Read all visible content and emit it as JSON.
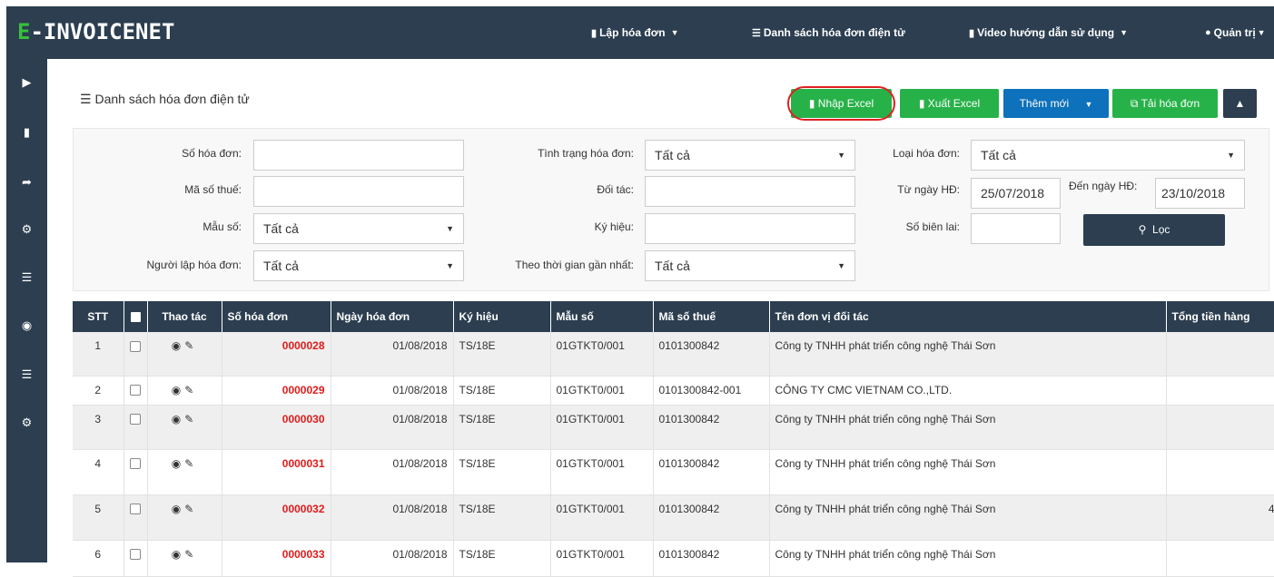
{
  "app": {
    "logo_e": "E",
    "logo_rest": "-INVOICENET"
  },
  "topnav": [
    {
      "icon": "file-icon",
      "label": "Lập hóa đơn",
      "caret": true
    },
    {
      "icon": "list-icon",
      "label": "Danh sách hóa đơn điện tử",
      "caret": false
    },
    {
      "icon": "file-icon",
      "label": "Video hướng dẫn sử dụng",
      "caret": true
    },
    {
      "icon": "user-icon",
      "label": "Quản trị",
      "caret": true
    }
  ],
  "sidebar": [
    "play-icon",
    "file-icon",
    "share-icon",
    "cogs-icon",
    "list-icon",
    "users-icon",
    "list-icon",
    "cogs-icon"
  ],
  "panel": {
    "title": "Danh sách hóa đơn điện tử"
  },
  "toolbar": {
    "import_excel": "Nhập Excel",
    "export_excel": "Xuất Excel",
    "add_new": "Thêm mới",
    "download": "Tải hóa đơn"
  },
  "filters": {
    "invoice_no_label": "Số hóa đơn:",
    "tax_code_label": "Mã số thuế:",
    "template_label": "Mẫu số:",
    "template_value": "Tất cả",
    "creator_label": "Người lập hóa đơn:",
    "creator_value": "Tất cả",
    "status_label": "Tình trạng hóa đơn:",
    "status_value": "Tất cả",
    "partner_label": "Đối tác:",
    "symbol_label": "Ký hiệu:",
    "recent_label": "Theo thời gian gần nhất:",
    "recent_value": "Tất cả",
    "type_label": "Loại hóa đơn:",
    "type_value": "Tất cả",
    "from_label": "Từ ngày HĐ:",
    "from_value": "25/07/2018",
    "to_label": "Đến ngày HĐ:",
    "to_value": "23/10/2018",
    "receipt_label": "Số biên lai:",
    "filter_button": "Lọc"
  },
  "table": {
    "headers": [
      "STT",
      "",
      "Thao tác",
      "Số hóa đơn",
      "Ngày hóa đơn",
      "Ký hiệu",
      "Mẫu số",
      "Mã số thuế",
      "Tên đơn vị đối tác",
      "Tổng tiền hàng"
    ],
    "rows": [
      {
        "stt": "1",
        "no": "0000028",
        "date": "01/08/2018",
        "symbol": "TS/18E",
        "template": "01GTKT0/001",
        "tax": "0101300842",
        "partner": "Công ty TNHH phát triển công nghệ Thái Sơn",
        "total": ""
      },
      {
        "stt": "2",
        "no": "0000029",
        "date": "01/08/2018",
        "symbol": "TS/18E",
        "template": "01GTKT0/001",
        "tax": "0101300842-001",
        "partner": "CÔNG TY CMC VIETNAM CO.,LTD.",
        "total": ""
      },
      {
        "stt": "3",
        "no": "0000030",
        "date": "01/08/2018",
        "symbol": "TS/18E",
        "template": "01GTKT0/001",
        "tax": "0101300842",
        "partner": "Công ty TNHH phát triển công nghệ Thái Sơn",
        "total": ""
      },
      {
        "stt": "4",
        "no": "0000031",
        "date": "01/08/2018",
        "symbol": "TS/18E",
        "template": "01GTKT0/001",
        "tax": "0101300842",
        "partner": "Công ty TNHH phát triển công nghệ Thái Sơn",
        "total": ""
      },
      {
        "stt": "5",
        "no": "0000032",
        "date": "01/08/2018",
        "symbol": "TS/18E",
        "template": "01GTKT0/001",
        "tax": "0101300842",
        "partner": "Công ty TNHH phát triển công nghệ Thái Sơn",
        "total": "4"
      },
      {
        "stt": "6",
        "no": "0000033",
        "date": "01/08/2018",
        "symbol": "TS/18E",
        "template": "01GTKT0/001",
        "tax": "0101300842",
        "partner": "Công ty TNHH phát triển công nghệ Thái Sơn",
        "total": ""
      }
    ]
  }
}
